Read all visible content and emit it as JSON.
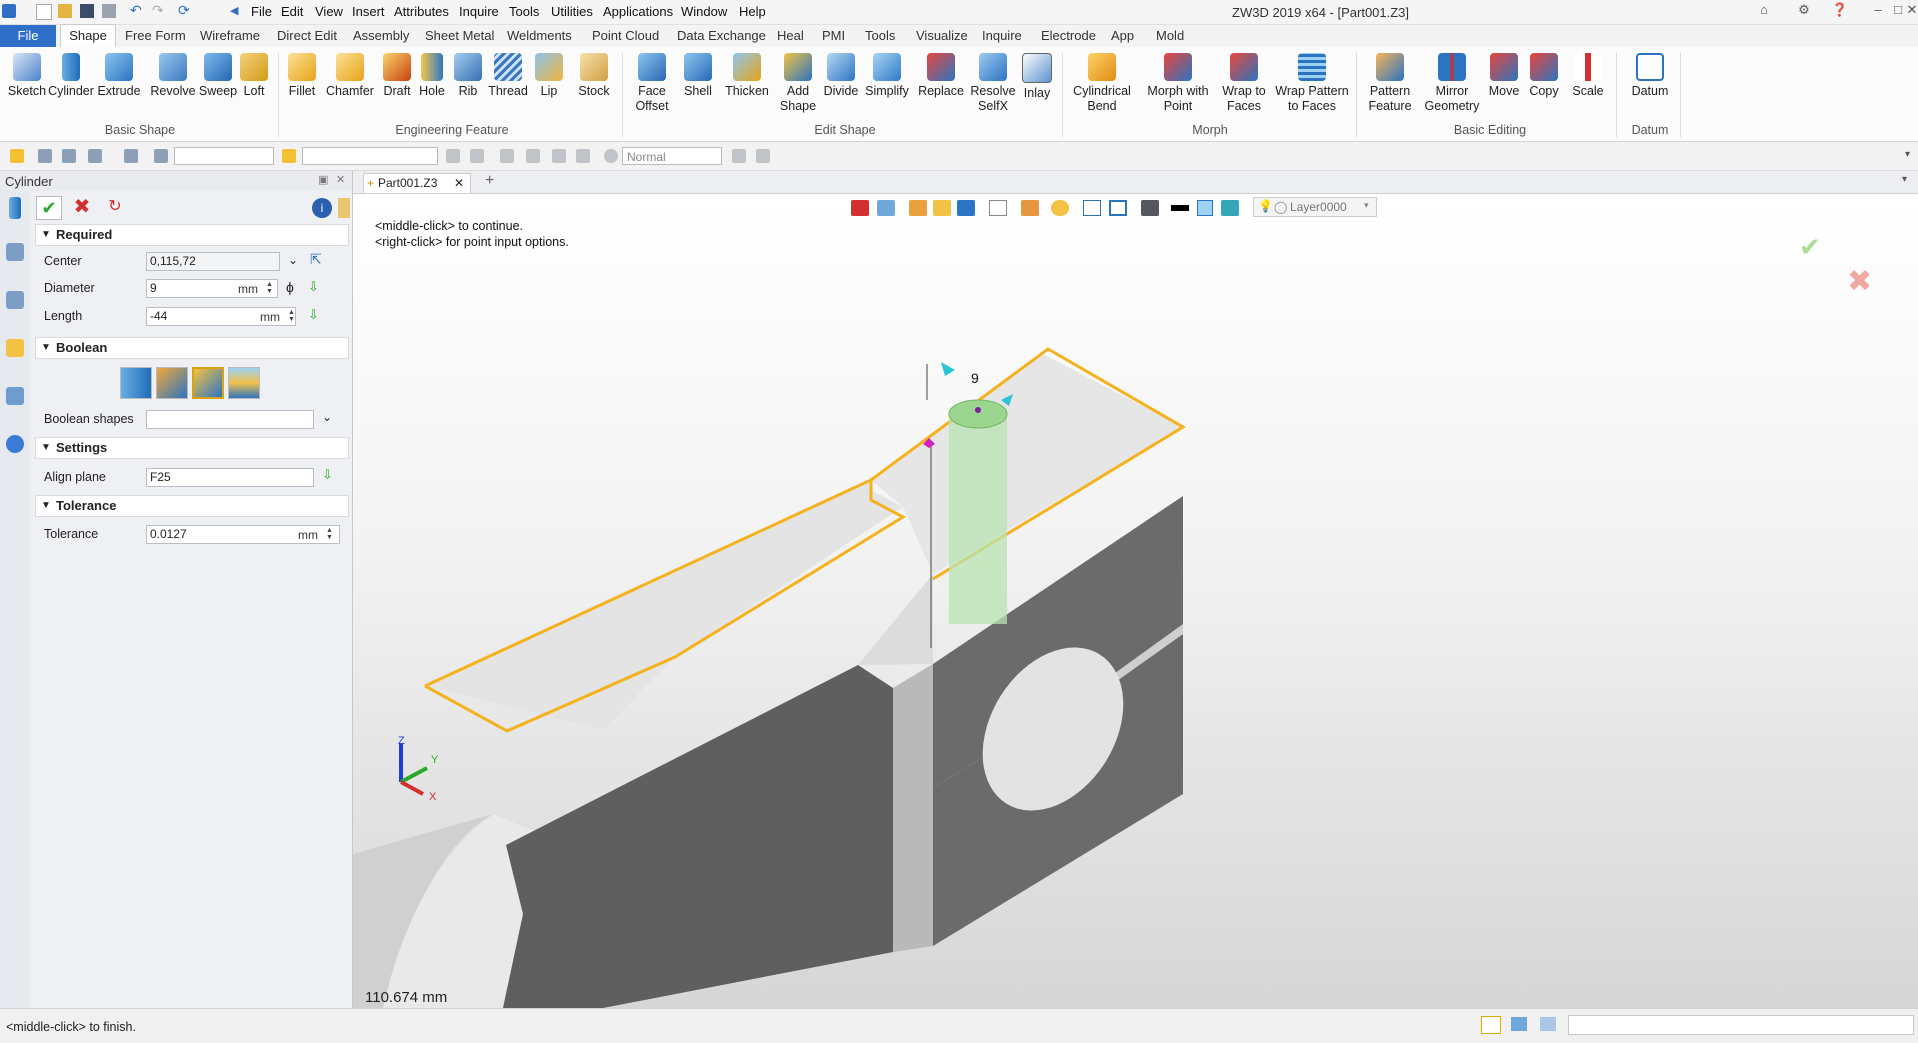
{
  "window": {
    "title": "ZW3D 2019  x64 - [Part001.Z3]"
  },
  "menu": [
    "File",
    "Edit",
    "View",
    "Insert",
    "Attributes",
    "Inquire",
    "Tools",
    "Utilities",
    "Applications",
    "Window",
    "Help"
  ],
  "ribbon_tabs": [
    "File",
    "Shape",
    "Free Form",
    "Wireframe",
    "Direct Edit",
    "Assembly",
    "Sheet Metal",
    "Weldments",
    "Point Cloud",
    "Data Exchange",
    "Heal",
    "PMI",
    "Tools",
    "Visualize",
    "Inquire",
    "Electrode",
    "App",
    "Mold"
  ],
  "ribbon": {
    "basic_shape": {
      "label": "Basic Shape",
      "buttons": [
        "Sketch",
        "Cylinder",
        "Extrude",
        "Revolve",
        "Sweep",
        "Loft"
      ]
    },
    "engineering_feature": {
      "label": "Engineering Feature",
      "buttons": [
        "Fillet",
        "Chamfer",
        "Draft",
        "Hole",
        "Rib",
        "Thread",
        "Lip",
        "Stock"
      ]
    },
    "edit_shape": {
      "label": "Edit Shape",
      "buttons": [
        "Face\nOffset",
        "Shell",
        "Thicken",
        "Add\nShape",
        "Divide",
        "Simplify",
        "Replace",
        "Resolve\nSelfX",
        "Inlay"
      ]
    },
    "morph": {
      "label": "Morph",
      "buttons": [
        "Cylindrical\nBend",
        "Morph with\nPoint",
        "Wrap to\nFaces",
        "Wrap Pattern\nto Faces"
      ]
    },
    "basic_editing": {
      "label": "Basic Editing",
      "buttons": [
        "Pattern\nFeature",
        "Mirror\nGeometry",
        "Move",
        "Copy",
        "Scale"
      ]
    },
    "datum": {
      "label": "Datum",
      "buttons": [
        "Datum"
      ]
    }
  },
  "toolbar2": {
    "render_mode": "Normal"
  },
  "panel": {
    "title": "Cylinder",
    "required": {
      "header": "Required",
      "center_label": "Center",
      "center_value": "0,115,72",
      "diameter_label": "Diameter",
      "diameter_value": "9",
      "diameter_unit": "mm",
      "length_label": "Length",
      "length_value": "-44",
      "length_unit": "mm"
    },
    "boolean": {
      "header": "Boolean",
      "shapes_label": "Boolean shapes",
      "shapes_value": ""
    },
    "settings": {
      "header": "Settings",
      "align_label": "Align plane",
      "align_value": "F25"
    },
    "tolerance": {
      "header": "Tolerance",
      "tol_label": "Tolerance",
      "tol_value": "0.0127",
      "tol_unit": "mm"
    }
  },
  "doc_tab": "Part001.Z3",
  "viewport": {
    "prompt1": "<middle-click> to continue.",
    "prompt2": "<right-click> for point input options.",
    "layer": "Layer0000",
    "dimension_label": "9",
    "distance": "110.674 mm",
    "triad": {
      "x": "X",
      "y": "Y",
      "z": "Z"
    }
  },
  "status": "<middle-click> to finish.",
  "colors": {
    "accent": "#2f6fc8",
    "highlight": "#f5b21e",
    "ok": "#2aa82a",
    "cancel": "#d23030"
  }
}
